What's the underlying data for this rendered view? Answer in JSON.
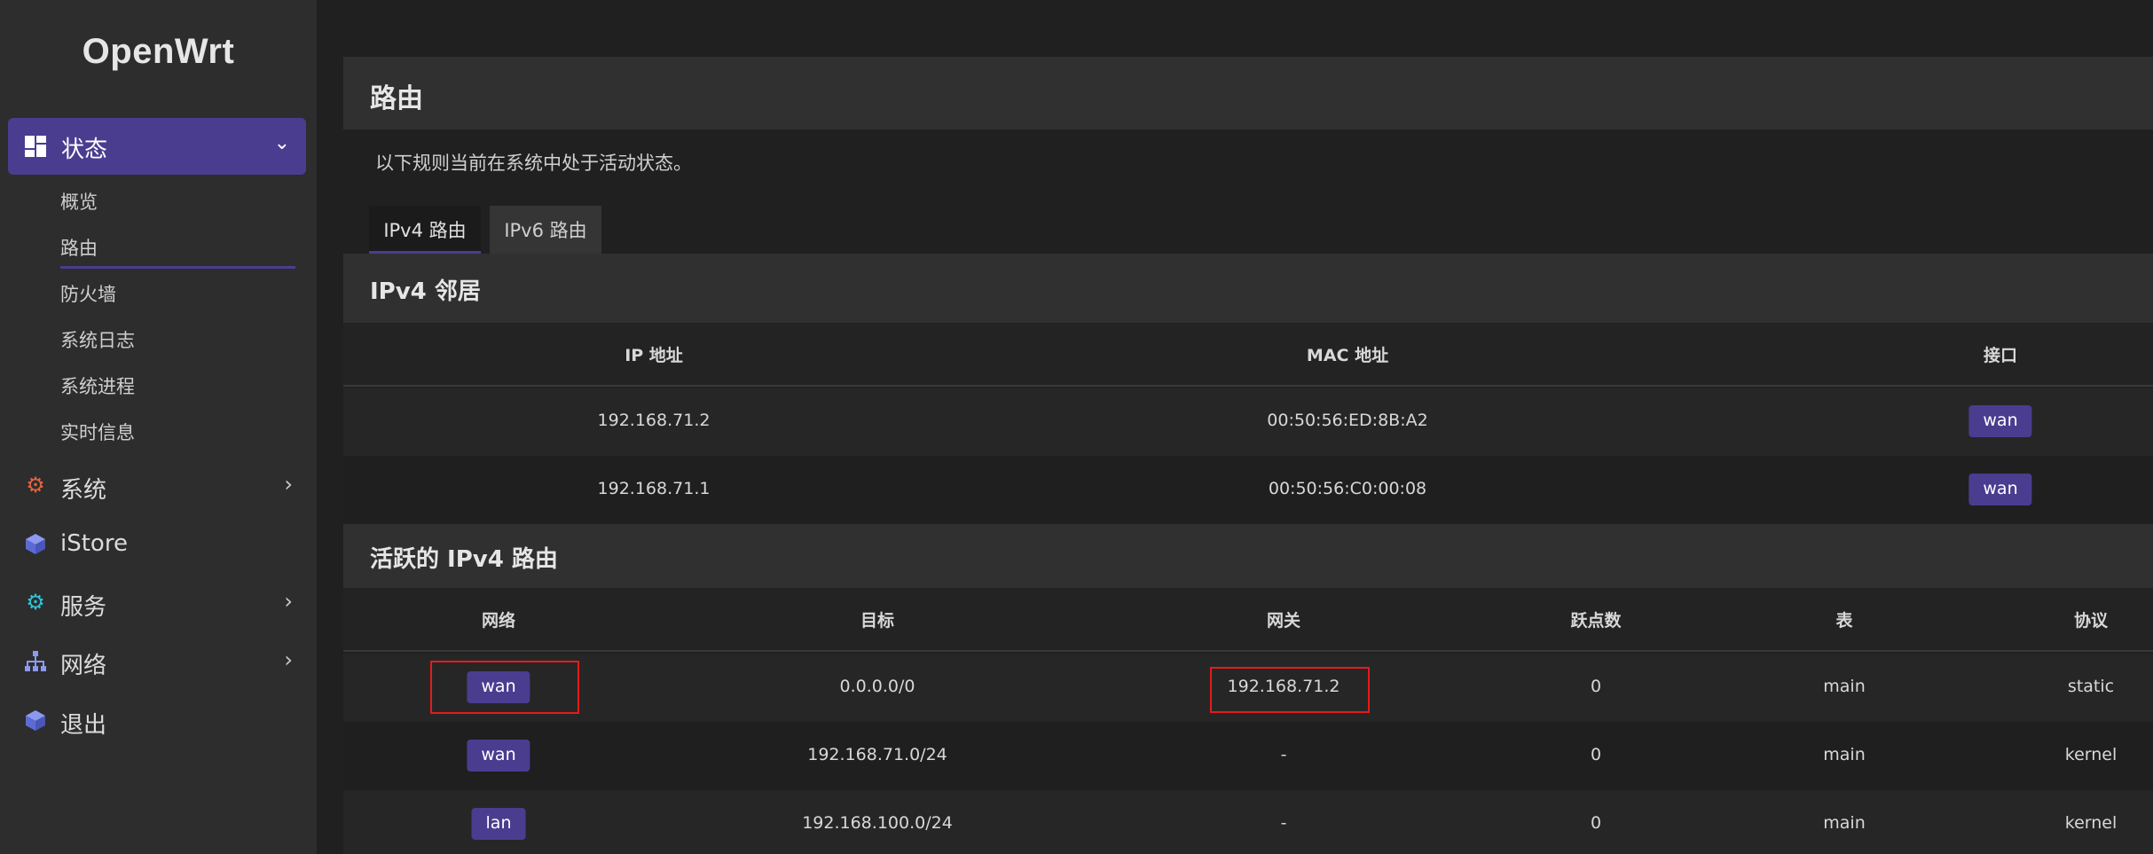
{
  "app": {
    "logo": "OpenWrt"
  },
  "sidebar": {
    "status": {
      "label": "状态"
    },
    "sub_items": [
      {
        "label": "概览"
      },
      {
        "label": "路由"
      },
      {
        "label": "防火墙"
      },
      {
        "label": "系统日志"
      },
      {
        "label": "系统进程"
      },
      {
        "label": "实时信息"
      }
    ],
    "menus": [
      {
        "label": "系统",
        "icon": "gear-icon",
        "color": "#e8623c"
      },
      {
        "label": "iStore",
        "icon": "cube-icon",
        "color": "#6b7de0"
      },
      {
        "label": "服务",
        "icon": "gears-icon",
        "color": "#2ec4d6"
      },
      {
        "label": "网络",
        "icon": "network-icon",
        "color": "#6b7de0"
      },
      {
        "label": "退出",
        "icon": "cube-icon",
        "color": "#6b7de0"
      }
    ]
  },
  "page": {
    "title": "路由",
    "description": "以下规则当前在系统中处于活动状态。",
    "tabs": [
      {
        "label": "IPv4 路由"
      },
      {
        "label": "IPv6 路由"
      }
    ]
  },
  "neighbors": {
    "title": "IPv4 邻居",
    "headers": [
      "IP 地址",
      "MAC 地址",
      "接口"
    ],
    "rows": [
      {
        "ip": "192.168.71.2",
        "mac": "00:50:56:ED:8B:A2",
        "iface": "wan"
      },
      {
        "ip": "192.168.71.1",
        "mac": "00:50:56:C0:00:08",
        "iface": "wan"
      }
    ]
  },
  "routes": {
    "title": "活跃的 IPv4 路由",
    "headers": [
      "网络",
      "目标",
      "网关",
      "跃点数",
      "表",
      "协议"
    ],
    "rows": [
      {
        "network": "wan",
        "target": "0.0.0.0/0",
        "gateway": "192.168.71.2",
        "metric": "0",
        "table": "main",
        "protocol": "static"
      },
      {
        "network": "wan",
        "target": "192.168.71.0/24",
        "gateway": "-",
        "metric": "0",
        "table": "main",
        "protocol": "kernel"
      },
      {
        "network": "lan",
        "target": "192.168.100.0/24",
        "gateway": "-",
        "metric": "0",
        "table": "main",
        "protocol": "kernel"
      }
    ]
  },
  "colors": {
    "accent": "#4a3d8f",
    "highlight": "#e41b1b"
  }
}
